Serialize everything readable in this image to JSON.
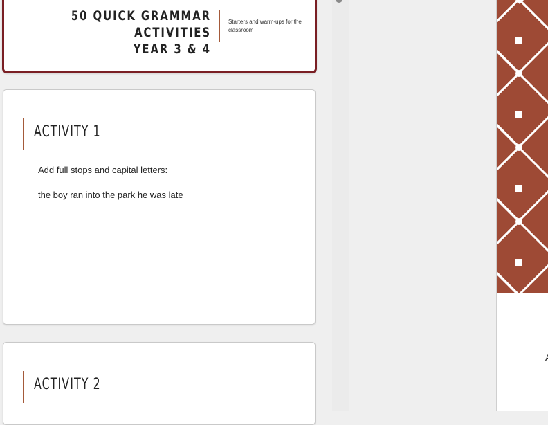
{
  "slides_panel": {
    "cover": {
      "title_line1": "50 QUICK GRAMMAR ACTIVITIES",
      "title_line2": "YEAR 3 & 4",
      "subtitle": "Starters and warm-ups for the classroom"
    },
    "activity1": {
      "title": "ACTIVITY 1",
      "instruction": "Add full stops and capital letters:",
      "sentence": "the boy ran into the park he was late"
    },
    "activity2": {
      "title": "ACTIVITY 2"
    }
  },
  "main_slide": {
    "partial_text": "A",
    "pattern_color": "#9e4a35"
  },
  "colors": {
    "selected_border": "#7a1f24",
    "accent_line": "#a45a3a"
  }
}
